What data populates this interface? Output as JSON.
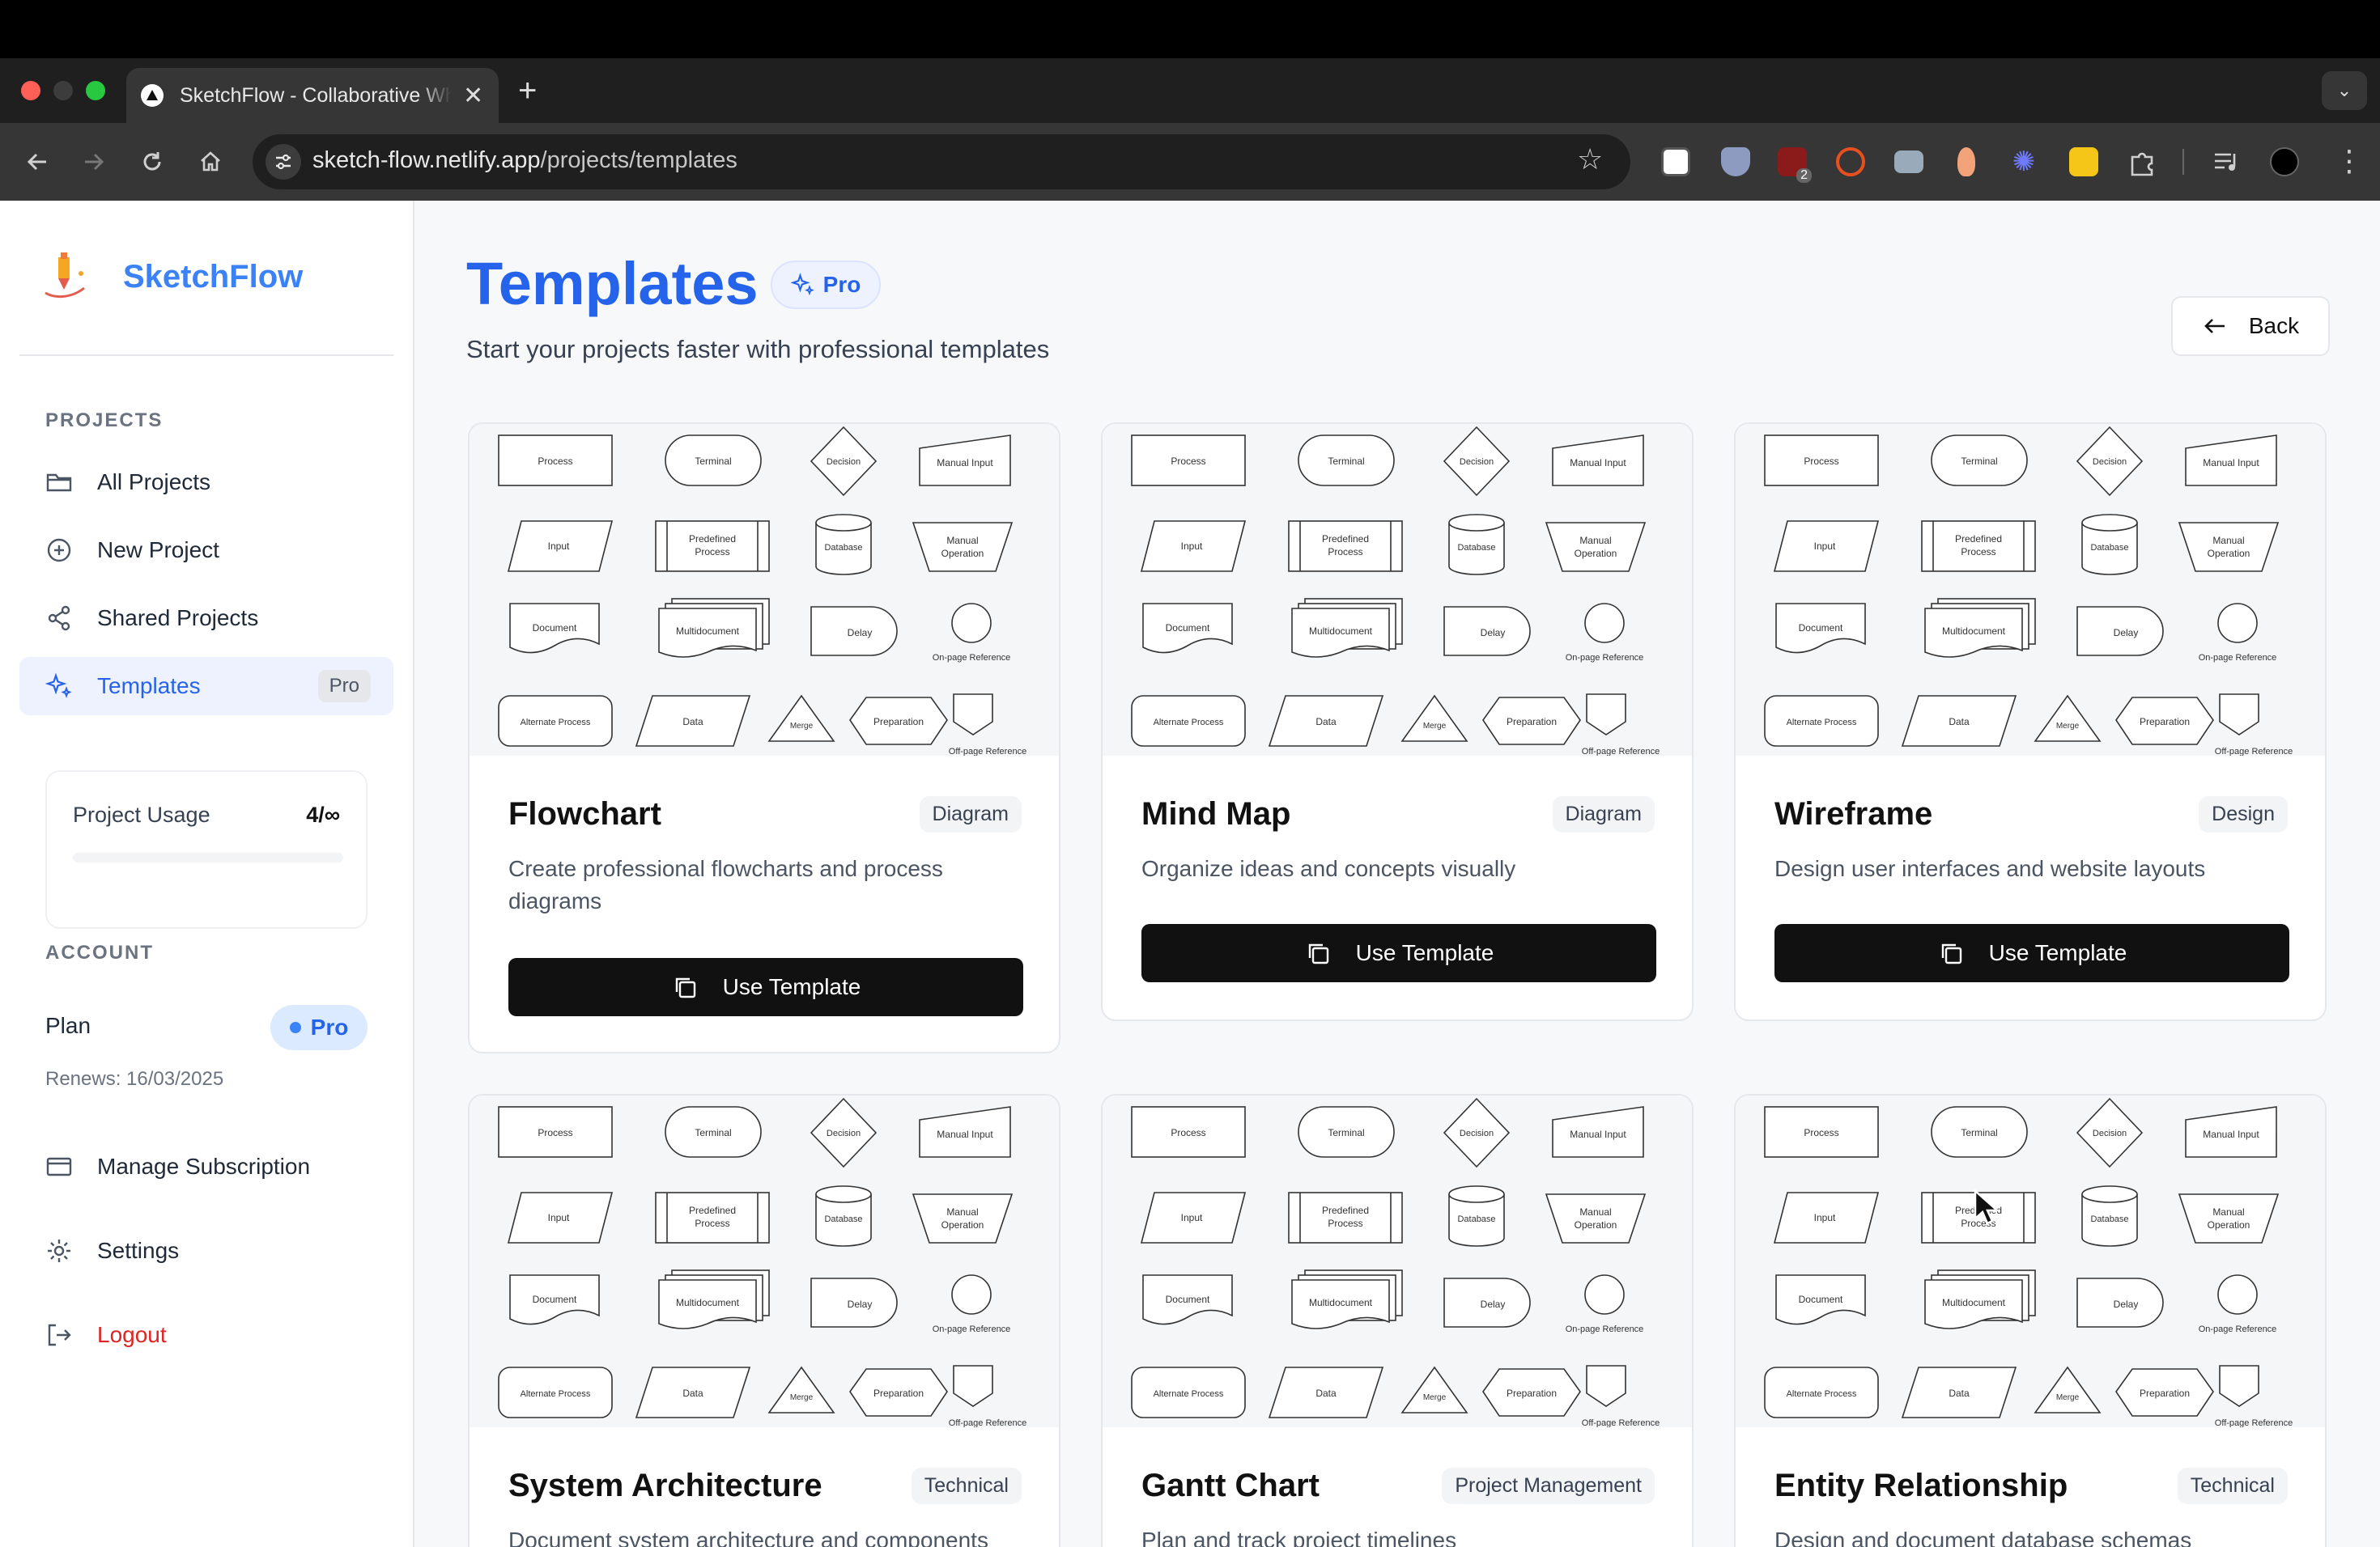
{
  "browser": {
    "tab_title": "SketchFlow - Collaborative Whiteboard",
    "url_host": "sketch-flow.netlify.app",
    "url_path": "/projects/templates",
    "extension_badge": "2"
  },
  "sidebar": {
    "brand": "SketchFlow",
    "projects_label": "PROJECTS",
    "items": [
      {
        "label": "All Projects"
      },
      {
        "label": "New Project"
      },
      {
        "label": "Shared Projects"
      },
      {
        "label": "Templates",
        "badge": "Pro"
      }
    ],
    "usage": {
      "label": "Project Usage",
      "value": "4/∞"
    },
    "account_label": "ACCOUNT",
    "plan_label": "Plan",
    "plan_badge": "Pro",
    "renews": "Renews: 16/03/2025",
    "manage_subscription": "Manage Subscription",
    "settings": "Settings",
    "logout": "Logout"
  },
  "main": {
    "title": "Templates",
    "pro_chip": "Pro",
    "subtitle": "Start your projects faster with professional templates",
    "back": "Back",
    "use_template": "Use Template",
    "shape_labels": {
      "process": "Process",
      "terminal": "Terminal",
      "decision": "Decision",
      "manual_input": "Manual Input",
      "input": "Input",
      "predefined_1": "Predefined",
      "predefined_2": "Process",
      "database": "Database",
      "manual_op_1": "Manual",
      "manual_op_2": "Operation",
      "document": "Document",
      "multidocument": "Multidocument",
      "delay": "Delay",
      "onpage": "On-page Reference",
      "alternate": "Alternate Process",
      "data": "Data",
      "merge": "Merge",
      "preparation": "Preparation",
      "offpage": "Off-page Reference"
    },
    "templates": [
      {
        "title": "Flowchart",
        "category": "Diagram",
        "description": "Create professional flowcharts and process diagrams"
      },
      {
        "title": "Mind Map",
        "category": "Diagram",
        "description": "Organize ideas and concepts visually"
      },
      {
        "title": "Wireframe",
        "category": "Design",
        "description": "Design user interfaces and website layouts"
      },
      {
        "title": "System Architecture",
        "category": "Technical",
        "description": "Document system architecture and components"
      },
      {
        "title": "Gantt Chart",
        "category": "Project Management",
        "description": "Plan and track project timelines"
      },
      {
        "title": "Entity Relationship",
        "category": "Technical",
        "description": "Design and document database schemas"
      }
    ]
  }
}
